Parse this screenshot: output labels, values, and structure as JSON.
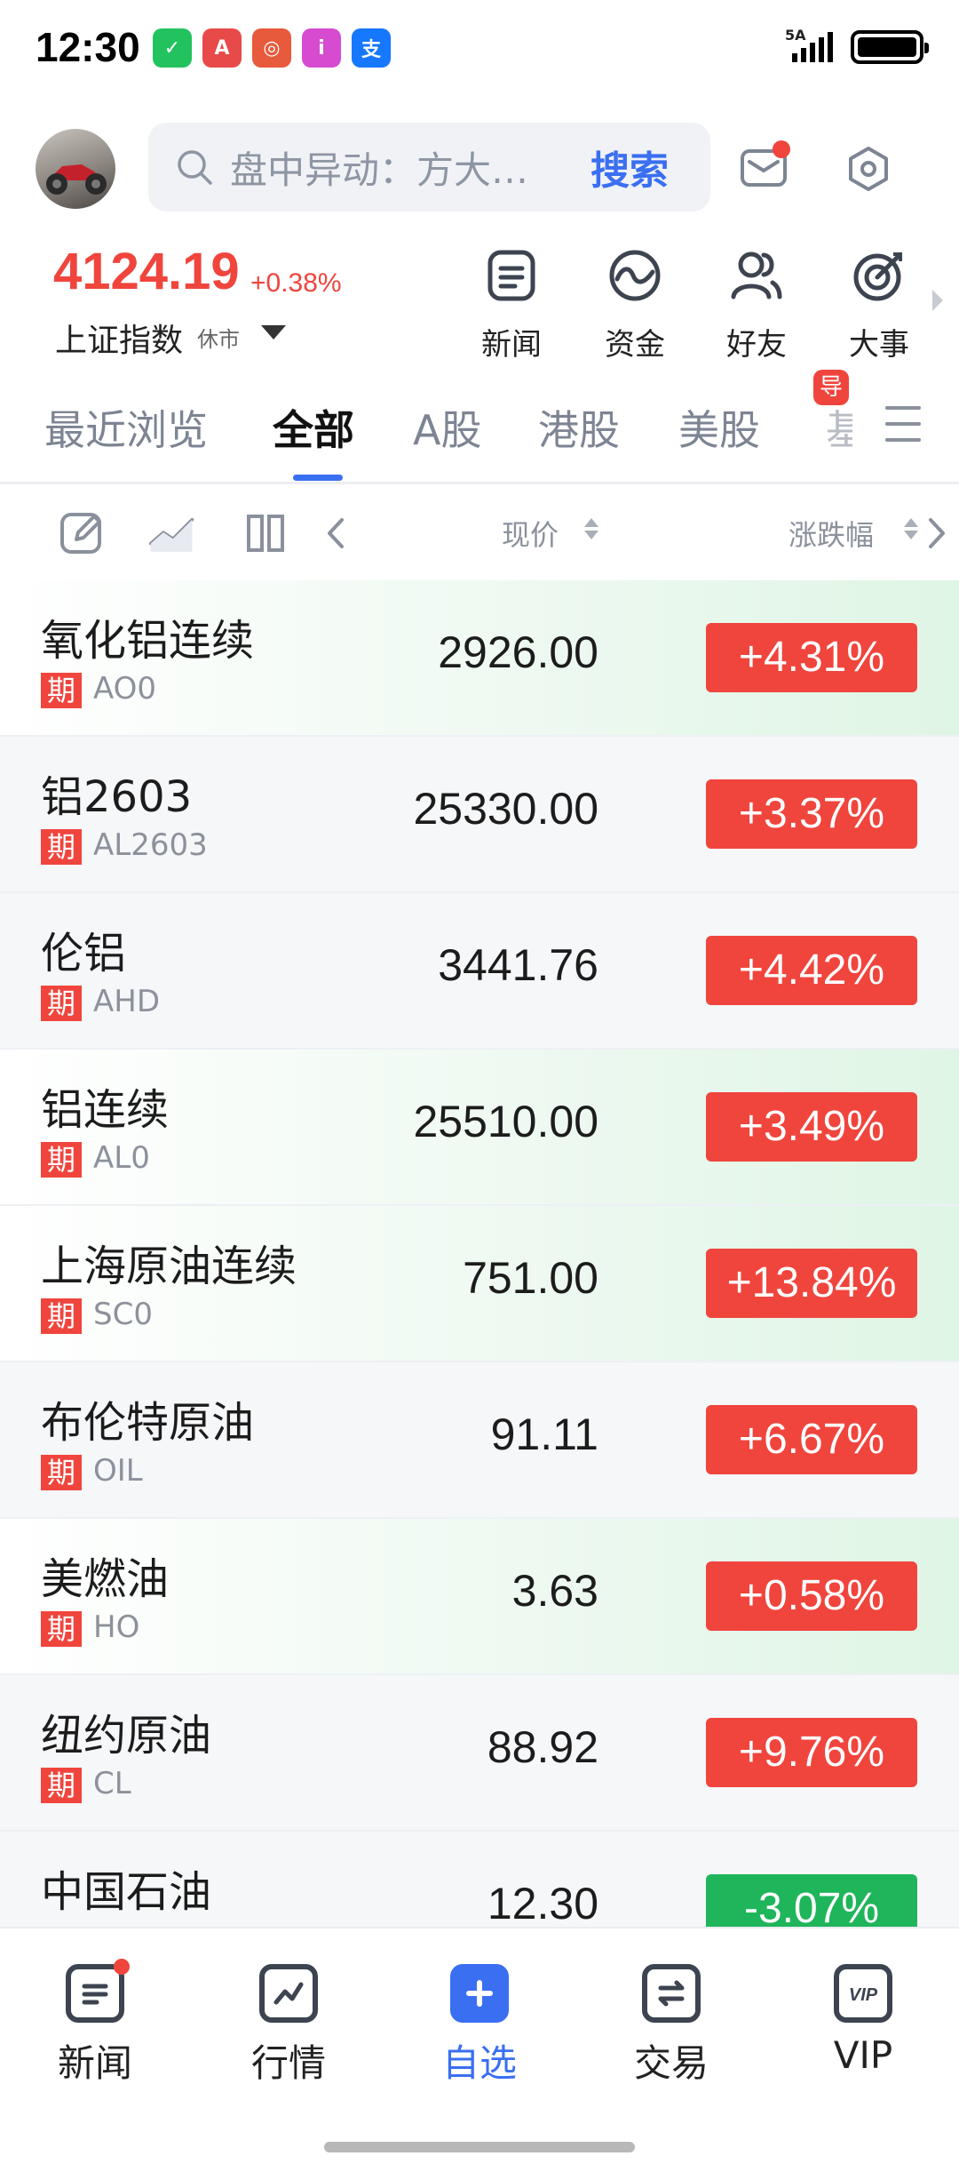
{
  "status_bar": {
    "time": "12:30",
    "network": "5A",
    "apps": [
      {
        "name": "wechat-app-icon",
        "glyph": "✓",
        "color": "#22c35e"
      },
      {
        "name": "appgallery-app-icon",
        "glyph": "A",
        "color": "#e84a4a"
      },
      {
        "name": "browser-app-icon",
        "glyph": "◎",
        "color": "#e85a3c"
      },
      {
        "name": "ithome-app-icon",
        "glyph": "i",
        "color": "#d64bd0"
      },
      {
        "name": "alipay-app-icon",
        "glyph": "支",
        "color": "#1677ff"
      }
    ]
  },
  "header": {
    "search_placeholder": "盘中异动：方大…",
    "search_button": "搜索"
  },
  "index": {
    "value": "4124.19",
    "change": "+0.38%",
    "name": "上证指数",
    "status": "休市"
  },
  "quick_menu": [
    {
      "label": "新闻",
      "icon": "news-icon"
    },
    {
      "label": "资金",
      "icon": "funds-icon"
    },
    {
      "label": "好友",
      "icon": "friends-icon"
    },
    {
      "label": "大事",
      "icon": "events-icon"
    }
  ],
  "tabs": [
    {
      "label": "最近浏览",
      "active": false
    },
    {
      "label": "全部",
      "active": true
    },
    {
      "label": "A股",
      "active": false
    },
    {
      "label": "港股",
      "active": false
    },
    {
      "label": "美股",
      "active": false
    }
  ],
  "tab_badge": "导",
  "tab_partial": "基",
  "columns": {
    "price": "现价",
    "change": "涨跌幅"
  },
  "colors": {
    "up": "#f0453d",
    "down": "#1fb55a",
    "accent": "#3a6ff1"
  },
  "rows": [
    {
      "name": "氧化铝连续",
      "tag": "期",
      "code": "AO0",
      "price": "2926.00",
      "change": "+4.31%",
      "direction": "up",
      "bg": "green"
    },
    {
      "name": "铝2603",
      "tag": "期",
      "code": "AL2603",
      "price": "25330.00",
      "change": "+3.37%",
      "direction": "up",
      "bg": "plain"
    },
    {
      "name": "伦铝",
      "tag": "期",
      "code": "AHD",
      "price": "3441.76",
      "change": "+4.42%",
      "direction": "up",
      "bg": "plain"
    },
    {
      "name": "铝连续",
      "tag": "期",
      "code": "AL0",
      "price": "25510.00",
      "change": "+3.49%",
      "direction": "up",
      "bg": "green"
    },
    {
      "name": "上海原油连续",
      "tag": "期",
      "code": "SC0",
      "price": "751.00",
      "change": "+13.84%",
      "direction": "up",
      "bg": "green"
    },
    {
      "name": "布伦特原油",
      "tag": "期",
      "code": "OIL",
      "price": "91.11",
      "change": "+6.67%",
      "direction": "up",
      "bg": "plain"
    },
    {
      "name": "美燃油",
      "tag": "期",
      "code": "HO",
      "price": "3.63",
      "change": "+0.58%",
      "direction": "up",
      "bg": "green"
    },
    {
      "name": "纽约原油",
      "tag": "期",
      "code": "CL",
      "price": "88.92",
      "change": "+9.76%",
      "direction": "up",
      "bg": "plain"
    },
    {
      "name": "中国石油",
      "tag": "",
      "code": "",
      "price": "12.30",
      "change": "-3.07%",
      "direction": "down",
      "bg": "plain"
    }
  ],
  "bottom_nav": [
    {
      "label": "新闻",
      "active": false
    },
    {
      "label": "行情",
      "active": false
    },
    {
      "label": "自选",
      "active": true
    },
    {
      "label": "交易",
      "active": false
    },
    {
      "label": "VIP",
      "active": false
    }
  ]
}
